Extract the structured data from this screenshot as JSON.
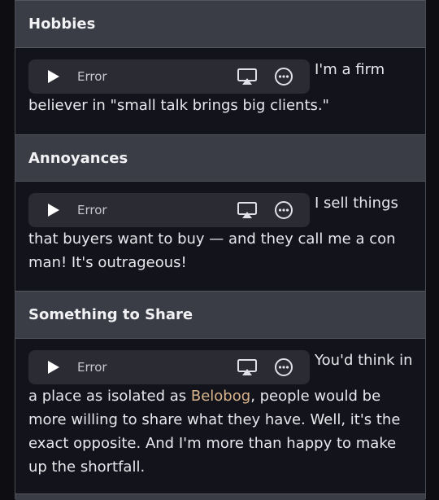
{
  "sections": [
    {
      "title": "Hobbies",
      "player": {
        "status": "Error"
      },
      "text_before": "I'm a firm believer in \"small talk brings big clients.\""
    },
    {
      "title": "Annoyances",
      "player": {
        "status": "Error"
      },
      "text_before": "I sell things that buyers want to buy — and they call me a con man! It's outrageous!"
    },
    {
      "title": "Something to Share",
      "player": {
        "status": "Error"
      },
      "text_a": "You'd think in a place as isolated as ",
      "link": "Belobog",
      "text_b": ", people would be more willing to share what they have. Well, it's the exact opposite. And I'm more than happy to make up the shortfall."
    }
  ],
  "colors": {
    "link": "#d9b38c",
    "header_bg": "#3a3c46",
    "body_bg": "#13141b"
  },
  "icons": [
    "play-icon",
    "airplay-icon",
    "more-options-icon"
  ]
}
